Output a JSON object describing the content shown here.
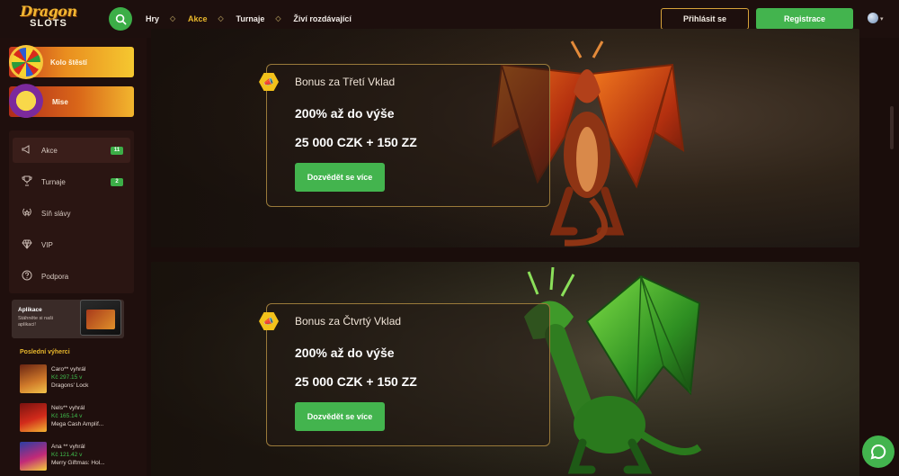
{
  "header": {
    "logo_top": "Dragon",
    "logo_bottom": "SLOTS",
    "nav": [
      {
        "label": "Hry",
        "active": false
      },
      {
        "label": "Akce",
        "active": true
      },
      {
        "label": "Turnaje",
        "active": false
      },
      {
        "label": "Živí rozdávající",
        "active": false
      }
    ],
    "login_label": "Přihlásit se",
    "register_label": "Registrace",
    "language_icon": "globe-icon"
  },
  "sidebar": {
    "wheel_label": "Kolo štěstí",
    "mise_label": "Mise",
    "menu": [
      {
        "label": "Akce",
        "count": "11",
        "icon": "megaphone-icon"
      },
      {
        "label": "Turnaje",
        "count": "2",
        "icon": "trophy-icon"
      },
      {
        "label": "Síň slávy",
        "count": "",
        "icon": "laurel-icon"
      },
      {
        "label": "VIP",
        "count": "",
        "icon": "diamond-icon"
      },
      {
        "label": "Podpora",
        "count": "",
        "icon": "question-icon"
      }
    ],
    "app": {
      "title": "Aplikace",
      "text": "Stáhněte si naši aplikaci!"
    },
    "winners_title": "Poslední výherci",
    "winners": [
      {
        "name": "Caro** vyhrál",
        "amount": "Kč 297.15 v",
        "game": "Dragons' Lock"
      },
      {
        "name": "Nels** vyhrál",
        "amount": "Kč 165.14 v",
        "game": "Mega Cash Amplif..."
      },
      {
        "name": "Ana ** vyhrál",
        "amount": "Kč 121.42 v",
        "game": "Merry Giftmas: Hol..."
      }
    ]
  },
  "promos": [
    {
      "title": "Bonus za Třetí Vklad",
      "line1": "200% až do výše",
      "line2": "25 000 CZK + 150 ZZ",
      "button": "Dozvědět se více"
    },
    {
      "title": "Bonus za Čtvrtý Vklad",
      "line1": "200% až do výše",
      "line2": "25 000 CZK + 150 ZZ",
      "button": "Dozvědět se více"
    }
  ],
  "colors": {
    "accent_green": "#43b44e",
    "accent_gold": "#e9b82c",
    "background": "#1a0d0b"
  }
}
